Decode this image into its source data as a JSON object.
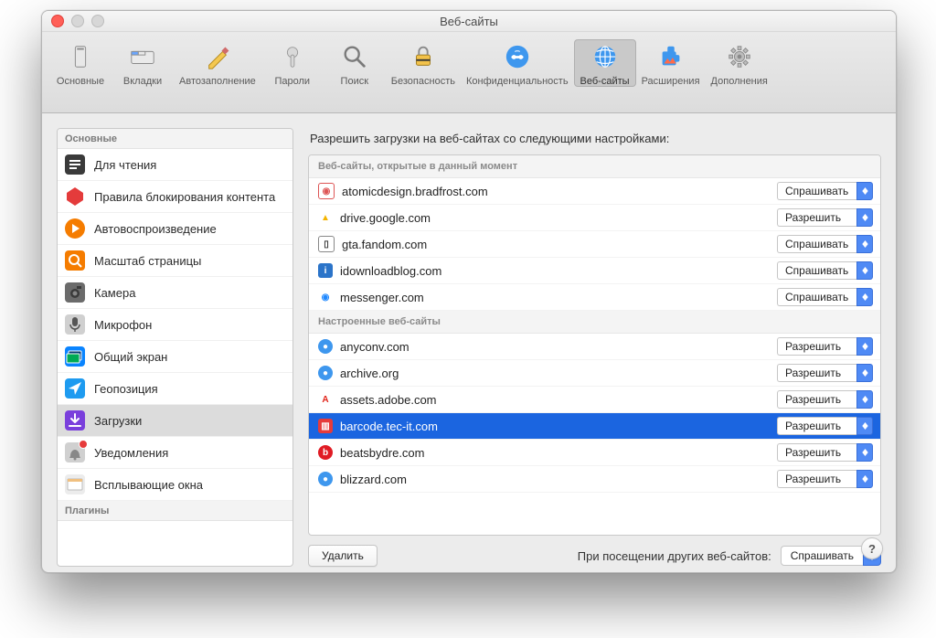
{
  "window": {
    "title": "Веб-сайты"
  },
  "toolbar": {
    "items": [
      {
        "id": "general",
        "label": "Основные",
        "selected": false
      },
      {
        "id": "tabs",
        "label": "Вкладки",
        "selected": false
      },
      {
        "id": "autofill",
        "label": "Автозаполнение",
        "selected": false
      },
      {
        "id": "passwords",
        "label": "Пароли",
        "selected": false
      },
      {
        "id": "search",
        "label": "Поиск",
        "selected": false
      },
      {
        "id": "security",
        "label": "Безопасность",
        "selected": false
      },
      {
        "id": "privacy",
        "label": "Конфиденциальность",
        "selected": false
      },
      {
        "id": "websites",
        "label": "Веб-сайты",
        "selected": true
      },
      {
        "id": "extensions",
        "label": "Расширения",
        "selected": false
      },
      {
        "id": "advanced",
        "label": "Дополнения",
        "selected": false
      }
    ]
  },
  "sidebar": {
    "header_general": "Основные",
    "header_plugins": "Плагины",
    "items": [
      {
        "id": "reader",
        "label": "Для чтения"
      },
      {
        "id": "contentblock",
        "label": "Правила блокирования контента"
      },
      {
        "id": "autoplay",
        "label": "Автовоспроизведение"
      },
      {
        "id": "zoom",
        "label": "Масштаб страницы"
      },
      {
        "id": "camera",
        "label": "Камера"
      },
      {
        "id": "mic",
        "label": "Микрофон"
      },
      {
        "id": "screen",
        "label": "Общий экран"
      },
      {
        "id": "location",
        "label": "Геопозиция"
      },
      {
        "id": "downloads",
        "label": "Загрузки",
        "selected": true
      },
      {
        "id": "notifications",
        "label": "Уведомления",
        "badge": true
      },
      {
        "id": "popups",
        "label": "Всплывающие окна"
      }
    ]
  },
  "main": {
    "title": "Разрешить загрузки на веб-сайтах со следующими настройками:",
    "group_open": "Веб-сайты, открытые в данный момент",
    "group_configured": "Настроенные веб-сайты",
    "open_sites": [
      {
        "domain": "atomicdesign.bradfrost.com",
        "action": "Спрашивать"
      },
      {
        "domain": "drive.google.com",
        "action": "Разрешить"
      },
      {
        "domain": "gta.fandom.com",
        "action": "Спрашивать"
      },
      {
        "domain": "idownloadblog.com",
        "action": "Спрашивать"
      },
      {
        "domain": "messenger.com",
        "action": "Спрашивать"
      }
    ],
    "configured_sites": [
      {
        "domain": "anyconv.com",
        "action": "Разрешить"
      },
      {
        "domain": "archive.org",
        "action": "Разрешить"
      },
      {
        "domain": "assets.adobe.com",
        "action": "Разрешить"
      },
      {
        "domain": "barcode.tec-it.com",
        "action": "Разрешить",
        "selected": true
      },
      {
        "domain": "beatsbydre.com",
        "action": "Разрешить"
      },
      {
        "domain": "blizzard.com",
        "action": "Разрешить"
      }
    ],
    "remove_label": "Удалить",
    "other_sites_label": "При посещении других веб-сайтов:",
    "other_sites_action": "Спрашивать"
  },
  "help": "?"
}
